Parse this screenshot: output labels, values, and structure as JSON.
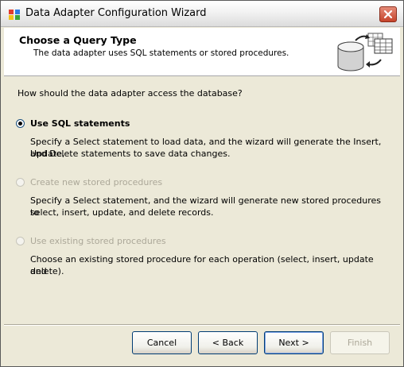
{
  "window": {
    "title": "Data Adapter Configuration Wizard"
  },
  "header": {
    "title": "Choose a Query Type",
    "subtitle": "The data adapter uses SQL statements or stored procedures."
  },
  "body": {
    "question": "How should the data adapter access the database?",
    "options": [
      {
        "label": "Use SQL statements",
        "selected": true,
        "enabled": true,
        "desc1": "Specify a Select statement to load data, and the wizard will generate the Insert, Update,",
        "desc2": "and Delete statements to save data changes."
      },
      {
        "label": "Create new stored procedures",
        "selected": false,
        "enabled": false,
        "desc1": "Specify a Select statement, and the wizard will generate new stored procedures to",
        "desc2": "select, insert, update, and delete records."
      },
      {
        "label": "Use existing stored procedures",
        "selected": false,
        "enabled": false,
        "desc1": "Choose an existing stored procedure for each operation (select, insert, update and",
        "desc2": "delete)."
      }
    ]
  },
  "buttons": {
    "cancel": "Cancel",
    "back": "< Back",
    "next": "Next >",
    "finish": "Finish"
  }
}
